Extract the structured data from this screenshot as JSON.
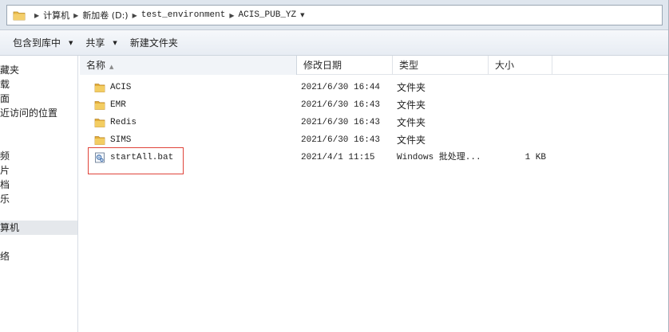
{
  "address": {
    "crumbs": [
      {
        "label": "计算机"
      },
      {
        "label": "新加卷 (D:)"
      },
      {
        "label": "test_environment"
      },
      {
        "label": "ACIS_PUB_YZ"
      }
    ]
  },
  "toolbar": {
    "include_library": "包含到库中",
    "share": "共享",
    "new_folder": "新建文件夹"
  },
  "nav": {
    "items": [
      "藏夹",
      "载",
      "面",
      "近访问的位置",
      "频",
      "片",
      "档",
      "乐",
      "算机",
      "络"
    ]
  },
  "columns": {
    "name": "名称",
    "date": "修改日期",
    "type": "类型",
    "size": "大小"
  },
  "files": [
    {
      "name": "ACIS",
      "date": "2021/6/30 16:44",
      "type": "文件夹",
      "size": "",
      "icon": "folder-icon"
    },
    {
      "name": "EMR",
      "date": "2021/6/30 16:43",
      "type": "文件夹",
      "size": "",
      "icon": "folder-icon"
    },
    {
      "name": "Redis",
      "date": "2021/6/30 16:43",
      "type": "文件夹",
      "size": "",
      "icon": "folder-icon"
    },
    {
      "name": "SIMS",
      "date": "2021/6/30 16:43",
      "type": "文件夹",
      "size": "",
      "icon": "folder-icon"
    },
    {
      "name": "startAll.bat",
      "date": "2021/4/1 11:15",
      "type": "Windows 批处理...",
      "size": "1 KB",
      "icon": "batch-file-icon"
    }
  ],
  "colors": {
    "highlight": "#e0443a",
    "folder": "#e8b94a"
  }
}
